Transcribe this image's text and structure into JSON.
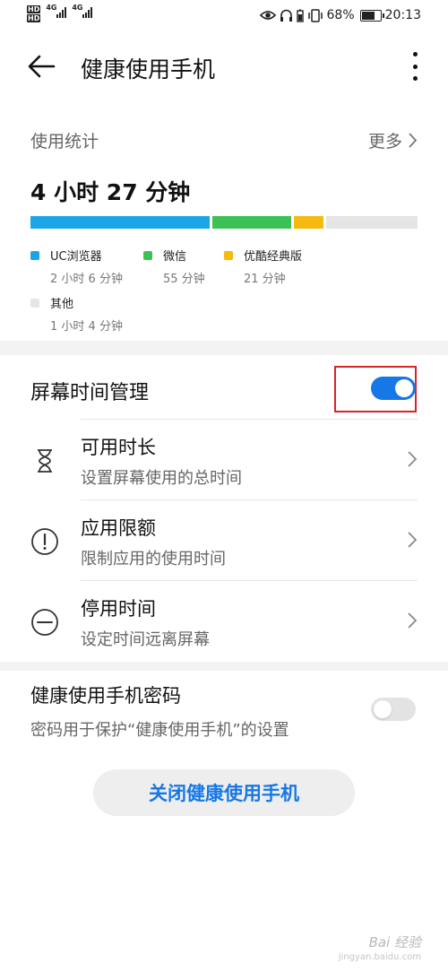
{
  "status_bar": {
    "hd1": "HD",
    "hd2": "HD",
    "net1": "4G",
    "net2": "4G",
    "battery_text": "68%",
    "battery_level": 0.68,
    "time": "20:13",
    "icons": [
      "eye-icon",
      "headphones-icon",
      "battery-saver-icon",
      "vibrate-icon"
    ]
  },
  "header": {
    "title": "健康使用手机",
    "back_icon": "arrow-left-icon",
    "menu_icon": "more-vertical-icon"
  },
  "usage": {
    "title": "使用统计",
    "more_label": "更多",
    "total": "4 小时 27 分钟",
    "apps": [
      {
        "name": "UC浏览器",
        "time": "2 小时 6 分钟",
        "minutes": 126,
        "color": "#1aa6e6"
      },
      {
        "name": "微信",
        "time": "55 分钟",
        "minutes": 55,
        "color": "#3cc254"
      },
      {
        "name": "优酷经典版",
        "time": "21 分钟",
        "minutes": 21,
        "color": "#f5b90f"
      },
      {
        "name": "其他",
        "time": "1 小时 4 分钟",
        "minutes": 64,
        "color": "#e5e5e5"
      }
    ]
  },
  "screen_time": {
    "label": "屏幕时间管理",
    "enabled": true,
    "items": [
      {
        "title": "可用时长",
        "subtitle": "设置屏幕使用的总时间",
        "icon": "hourglass-icon"
      },
      {
        "title": "应用限额",
        "subtitle": "限制应用的使用时间",
        "icon": "exclamation-circle-icon"
      },
      {
        "title": "停用时间",
        "subtitle": "设定时间远离屏幕",
        "icon": "minus-circle-icon"
      }
    ]
  },
  "password": {
    "title": "健康使用手机密码",
    "subtitle": "密码用于保护“健康使用手机”的设置",
    "enabled": false
  },
  "close_button": "关闭健康使用手机",
  "watermark": {
    "text": "Bai 经验",
    "sub": "jingyan.baidu.com"
  },
  "colors": {
    "accent": "#1677e6",
    "highlight": "#d9232a"
  }
}
